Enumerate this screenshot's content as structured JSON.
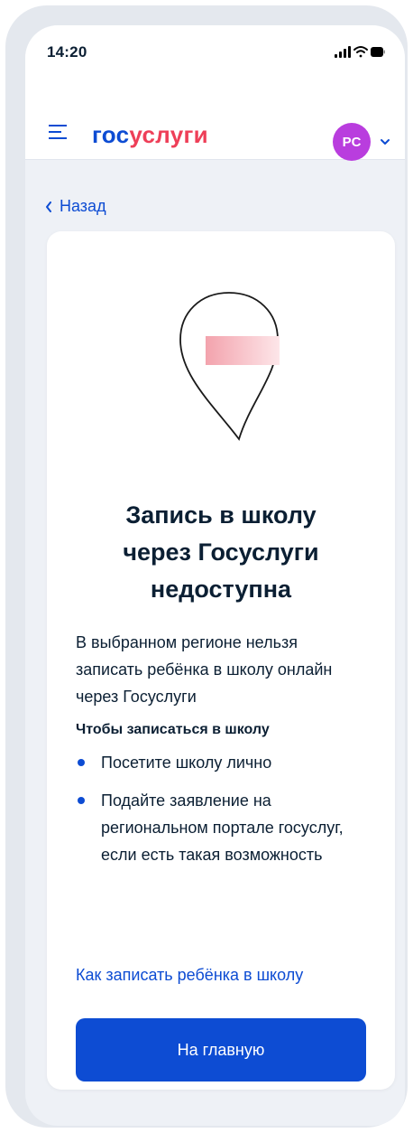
{
  "status_bar": {
    "time": "14:20"
  },
  "header": {
    "logo_part1": "гос",
    "logo_part2": "услуги",
    "avatar_initials": "PC",
    "brand_blue": "#0d4cd3",
    "brand_red": "#ee3f58",
    "avatar_color": "#b93dde"
  },
  "nav": {
    "back_label": "Назад"
  },
  "card": {
    "illustration": "map-pin-icon",
    "title_lines": [
      "Запись в школу",
      "через Госуслуги",
      "недоступна"
    ],
    "description": "В выбранном регионе нельзя записать ребёнка в школу онлайн через Госуслуги",
    "subheading": "Чтобы записаться в школу",
    "steps": [
      "Посетите школу лично",
      "Подайте заявление на региональном портале госуслуг, если есть такая возможность"
    ],
    "link_label": "Как записать ребёнка в школу",
    "primary_button": "На главную"
  }
}
